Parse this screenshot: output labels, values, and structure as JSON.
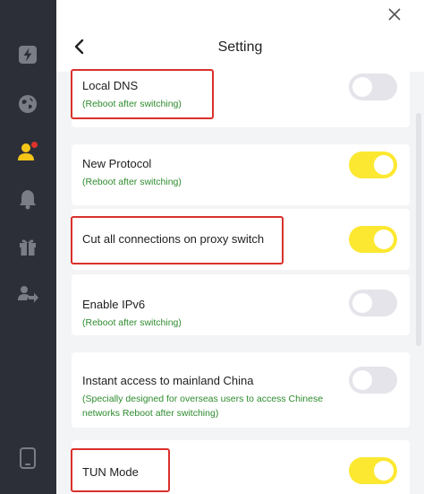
{
  "header": {
    "title": "Setting",
    "back_icon": "chevron-left-icon",
    "close_icon": "close-icon"
  },
  "sidebar": {
    "items": [
      {
        "icon": "lightning-icon"
      },
      {
        "icon": "globe-icon"
      },
      {
        "icon": "user-icon",
        "badge": true
      },
      {
        "icon": "bell-icon"
      },
      {
        "icon": "gift-icon"
      },
      {
        "icon": "share-icon"
      },
      {
        "icon": "device-icon"
      }
    ]
  },
  "settings": [
    {
      "title": "Local DNS",
      "subtitle": "(Reboot after switching)",
      "enabled": false
    },
    {
      "title": "New Protocol",
      "subtitle": "(Reboot after switching)",
      "enabled": true
    },
    {
      "title": "Cut all connections on proxy switch",
      "subtitle": "",
      "enabled": true
    },
    {
      "title": "Enable IPv6",
      "subtitle": "(Reboot after switching)",
      "enabled": false
    },
    {
      "title": "Instant access to mainland China",
      "subtitle_line1": "(Specially designed for overseas users to access Chinese",
      "subtitle_line2": "networks Reboot after switching)",
      "enabled": false
    },
    {
      "title": "TUN Mode",
      "subtitle": "",
      "enabled": true
    }
  ],
  "colors": {
    "sidebar_bg": "#2c2f38",
    "toggle_on": "#fce831",
    "toggle_off": "#e4e4ea",
    "subtitle_green": "#2e8b2e",
    "highlight_red": "#d9312c",
    "badge_red": "#e0322c",
    "active_icon": "#f5c518"
  }
}
